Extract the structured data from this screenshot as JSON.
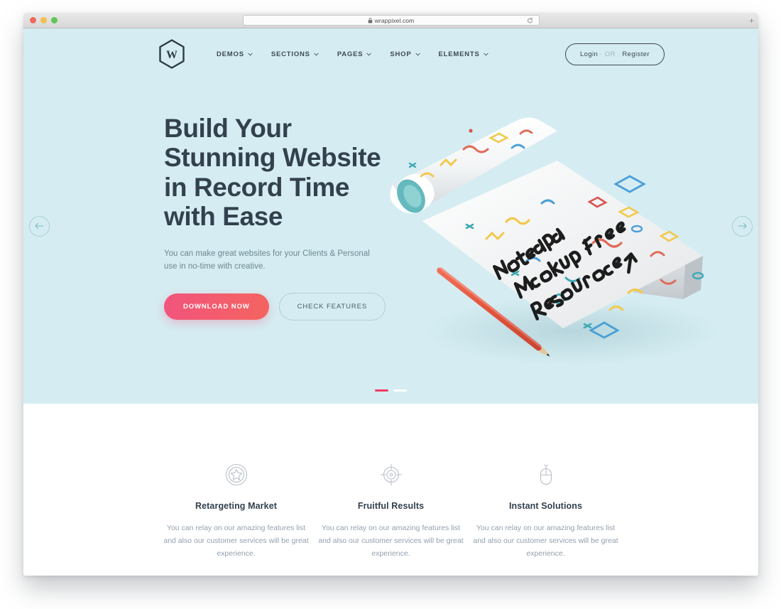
{
  "browser": {
    "url": "wrappixel.com",
    "lock_icon": "lock-icon",
    "reload_icon": "reload-icon",
    "new_tab_label": "+",
    "traffic_lights": [
      "close-red",
      "minimize-yellow",
      "maximize-green"
    ]
  },
  "nav": {
    "logo_letter": "W",
    "logo_icon": "hexagon-logo-icon",
    "items": [
      {
        "label": "DEMOS",
        "icon": "chevron-down-icon"
      },
      {
        "label": "SECTIONS",
        "icon": "chevron-down-icon"
      },
      {
        "label": "PAGES",
        "icon": "chevron-down-icon"
      },
      {
        "label": "SHOP",
        "icon": "chevron-down-icon"
      },
      {
        "label": "ELEMENTS",
        "icon": "chevron-down-icon"
      }
    ],
    "auth": {
      "login_label": "Login",
      "separator_left": "·",
      "or_label": "OR",
      "separator_right": "·",
      "register_label": "Register"
    }
  },
  "hero": {
    "title": "Build Your Stunning Website in Record Time with Ease",
    "subtitle": "You can make great websites for your Clients & Personal use in no-time with creative.",
    "primary_button": "DOWNLOAD NOW",
    "secondary_button": "CHECK FEATURES",
    "background_color": "#d5edf2",
    "accent_color": "#f2547d",
    "artwork": {
      "name": "notepad-mockup-illustration",
      "handwritten_text": "Notepad Mockup Free Resource",
      "pencil_color": "#e8573f"
    },
    "prev_arrow_icon": "arrow-left-icon",
    "next_arrow_icon": "arrow-right-icon",
    "slides": [
      {
        "active": true
      },
      {
        "active": false
      }
    ]
  },
  "features": [
    {
      "icon": "star-badge-icon",
      "title": "Retargeting Market",
      "text": "You can relay on our amazing features list and also our customer services will be great experience."
    },
    {
      "icon": "target-crosshair-icon",
      "title": "Fruitful Results",
      "text": "You can relay on our amazing features list and also our customer services will be great experience."
    },
    {
      "icon": "computer-mouse-icon",
      "title": "Instant Solutions",
      "text": "You can relay on our amazing features list and also our customer services will be great experience."
    }
  ]
}
